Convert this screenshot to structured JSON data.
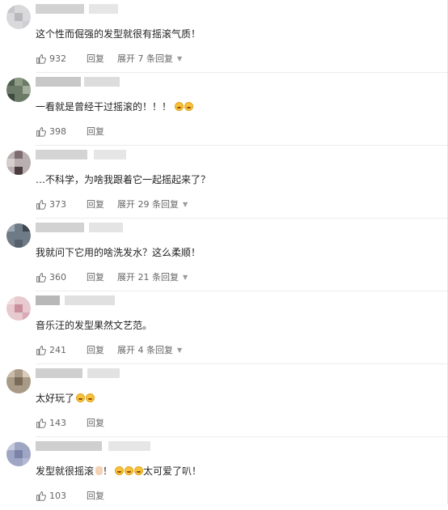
{
  "actions": {
    "reply_label": "回复"
  },
  "colors": {
    "text": "#222222",
    "meta": "#666666",
    "divider": "#ececec"
  },
  "comments": [
    {
      "text": "这个性而倔强的发型就很有摇滚气质！",
      "likes": "932",
      "expand": "展开 7 条回复",
      "emojis": []
    },
    {
      "text": "一看就是曾经干过摇滚的！！！",
      "likes": "398",
      "expand": "",
      "emojis": [
        "laugh-cry-emoji",
        "laugh-cry-emoji"
      ]
    },
    {
      "text": "…不科学，为啥我跟着它一起摇起来了？",
      "likes": "373",
      "expand": "展开 29 条回复",
      "emojis": []
    },
    {
      "text": "我就问下它用的啥洗发水？这么柔顺！",
      "likes": "360",
      "expand": "展开 21 条回复",
      "emojis": []
    },
    {
      "text": "音乐汪的发型果然文艺范。",
      "likes": "241",
      "expand": "展开 4 条回复",
      "emojis": []
    },
    {
      "text": "太好玩了",
      "likes": "143",
      "expand": "",
      "emojis": [
        "laugh-cry-emoji",
        "laugh-cry-emoji"
      ]
    },
    {
      "text": "发型就很摇滚",
      "text_mid": "！",
      "text_end": "太可爱了叭！",
      "likes": "103",
      "expand": "",
      "emojis": [
        "laugh-cry-emoji",
        "laugh-cry-emoji",
        "laugh-cry-emoji"
      ]
    }
  ]
}
